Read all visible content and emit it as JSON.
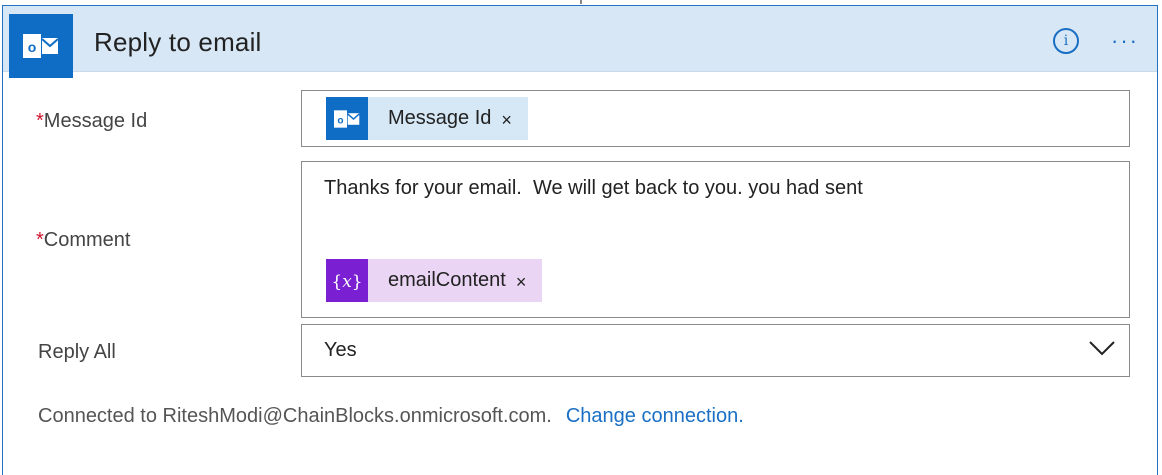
{
  "header": {
    "title": "Reply to email",
    "icon": "outlook-icon",
    "info_icon_glyph": "i",
    "more_glyph": "···"
  },
  "fields": {
    "message_id": {
      "required_mark": "*",
      "label": "Message Id",
      "token": {
        "icon": "outlook-icon",
        "label": "Message Id",
        "remove_glyph": "×"
      }
    },
    "comment": {
      "required_mark": "*",
      "label": "Comment",
      "text": "Thanks for your email.  We will get back to you. you had sent",
      "token": {
        "icon": "variable-icon",
        "label": "emailContent",
        "remove_glyph": "×"
      }
    },
    "reply_all": {
      "label": "Reply All",
      "value": "Yes"
    }
  },
  "footer": {
    "connected_text": "Connected to RiteshModi@ChainBlocks.onmicrosoft.com.",
    "change_link": "Change connection."
  },
  "colors": {
    "header_bg": "#d7e7f5",
    "outlook_blue": "#0f6dc6",
    "token_blue_bg": "#d6e7f5",
    "variable_purple": "#7a1fd1",
    "token_purple_bg": "#ead6f4",
    "link": "#1a6fc4",
    "required": "#d1142c"
  }
}
